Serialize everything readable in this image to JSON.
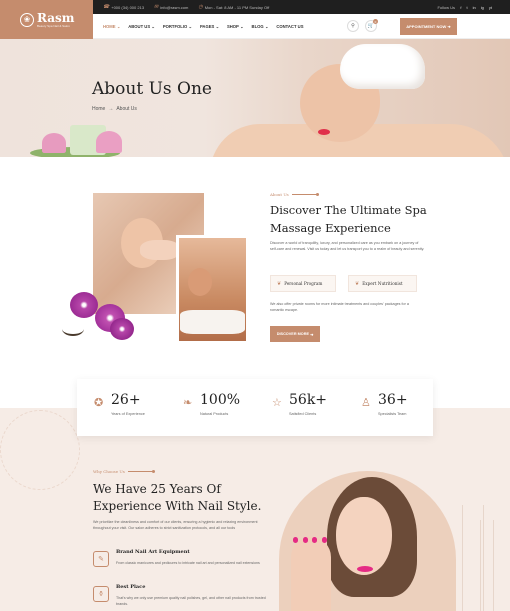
{
  "brand": {
    "name": "Rasm",
    "tagline": "Beauty Spa Nail & Salon",
    "accent": "#c58c6d",
    "logo_icon": "lotus-icon"
  },
  "topbar": {
    "phone": "+000 (34) 000 213",
    "email": "info@rasm.com",
    "hours": "Mon - Sat: 8 AM - 11 PM Sunday Off",
    "follow_label": "Follow Us",
    "socials": [
      "f",
      "t",
      "in",
      "ig",
      "yt"
    ]
  },
  "nav": {
    "items": [
      "HOME",
      "ABOUT US",
      "PORTFOLIO",
      "PAGES",
      "SHOP",
      "BLOG",
      "CONTACT US"
    ],
    "active": "HOME",
    "cart_count": "0",
    "appointment_label": "APPOINTMENT NOW"
  },
  "hero": {
    "title": "About Us One",
    "breadcrumb_home": "Home",
    "breadcrumb_sep": "→",
    "breadcrumb_current": "About Us"
  },
  "about": {
    "tag": "About Us",
    "title": "Discover The Ultimate Spa Massage Experience",
    "paragraph": "Discover a world of tranquility, luxury, and personalized care as you embark on a journey of self-care and renewal. Visit us today and let us transport you to a realm of beauty and serenity.",
    "features": [
      "Personal Program",
      "Expert Nutritionist"
    ],
    "paragraph2": "We also offer private rooms for more intimate treatments and couples' packages for a romantic escape.",
    "button_label": "DISCOVER MORE"
  },
  "stats": [
    {
      "icon": "award-icon",
      "value": "26+",
      "label": "Years of Experience"
    },
    {
      "icon": "leaf-icon",
      "value": "100%",
      "label": "Natural Products"
    },
    {
      "icon": "thumbs-up-icon",
      "value": "56k+",
      "label": "Satisfied Clients"
    },
    {
      "icon": "specialist-icon",
      "value": "36+",
      "label": "Specialists Team"
    }
  ],
  "why": {
    "tag": "Why Choose Us",
    "title": "We Have 25 Years Of Experience With Nail Style.",
    "paragraph": "We prioritize the cleanliness and comfort of our clients, ensuring a hygienic and relaxing environment throughout your visit. Our salon adheres to strict sanitization protocols, and all our tools",
    "items": [
      {
        "icon": "nail-art-icon",
        "title": "Brand Nail Art Equipment",
        "desc": "From classic manicures and pedicures to intricate nail art and personalized nail extensions"
      },
      {
        "icon": "polish-icon",
        "title": "Best Place",
        "desc": "That's why we only use premium quality nail polishes, gel, and other nail products from trusted brands."
      }
    ]
  }
}
